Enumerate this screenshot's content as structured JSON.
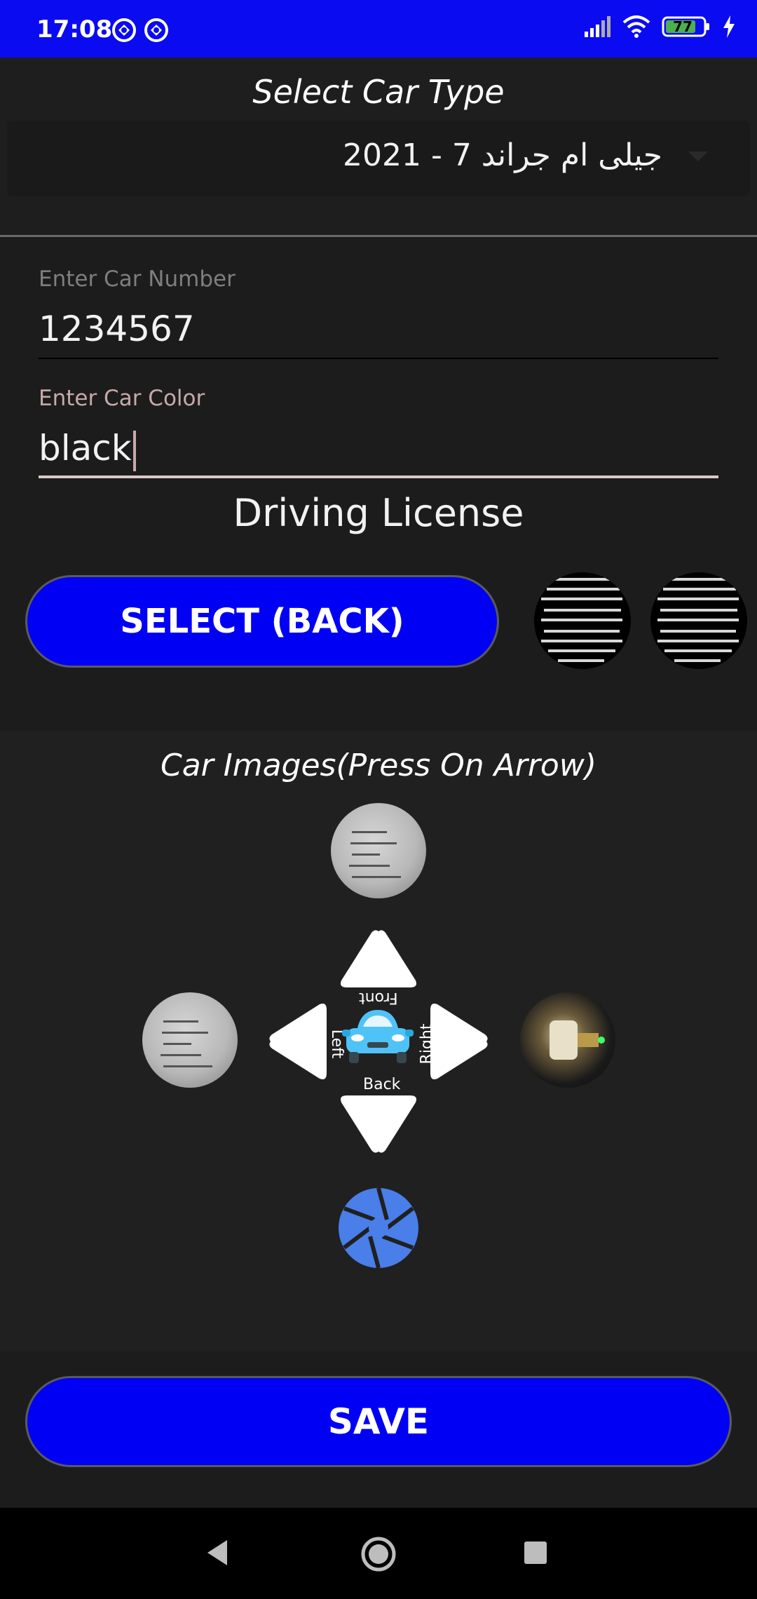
{
  "status_bar": {
    "time": "17:08",
    "battery_level": "77",
    "background_color": "#0b0bf2"
  },
  "car_type": {
    "title": "Select Car Type",
    "selected_value": "جيلى ام جراند 7 - 2021"
  },
  "car_number": {
    "label": "Enter Car Number",
    "value": "1234567"
  },
  "car_color": {
    "label": "Enter Car Color",
    "value": "black",
    "label_color": "#c8a9a9"
  },
  "driving_license": {
    "title": "Driving License",
    "select_button_label": "SELECT (BACK)",
    "thumbnails": [
      "license-front-thumb",
      "license-back-thumb"
    ]
  },
  "car_images": {
    "title": "Car Images(Press On Arrow)",
    "arrow_labels": {
      "front": "Front",
      "left": "Left",
      "right": "Right",
      "back": "Back"
    },
    "icons": {
      "car": "car-icon",
      "camera": "camera-shutter-icon"
    }
  },
  "save_button_label": "SAVE",
  "colors": {
    "accent": "#0000f5",
    "camera_icon": "#4a7ee8",
    "car_icon": "#4fc3f7"
  }
}
